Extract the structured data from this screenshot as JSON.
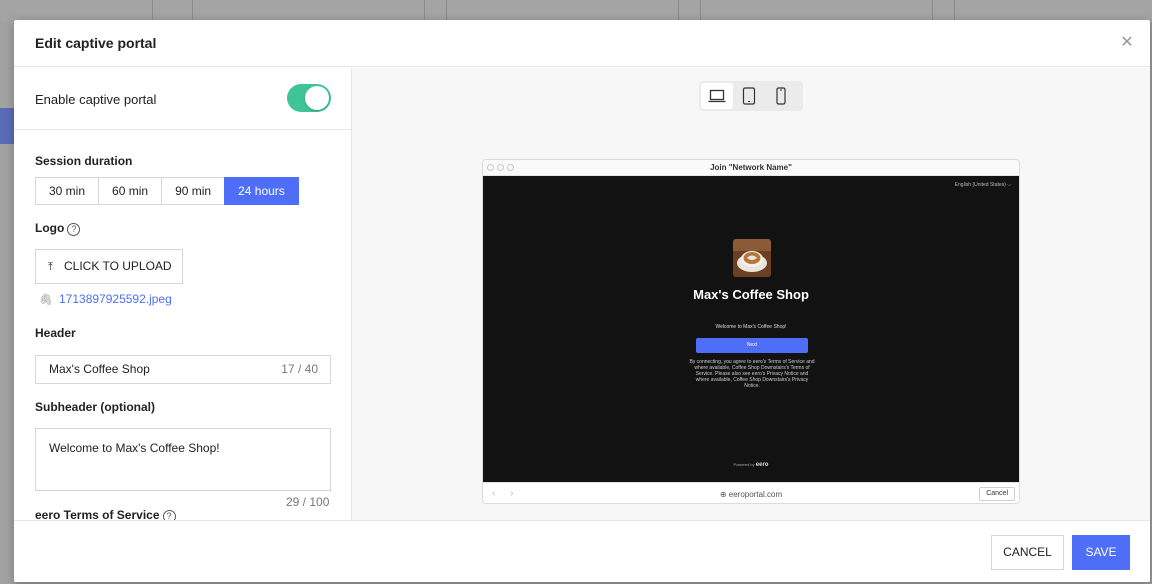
{
  "modal": {
    "title": "Edit captive portal",
    "close_glyph": "✕"
  },
  "form": {
    "enable_label": "Enable captive portal",
    "enable_on": true,
    "session_label": "Session duration",
    "session_options": [
      "30 min",
      "60 min",
      "90 min",
      "24 hours"
    ],
    "session_selected": "24 hours",
    "logo_label": "Logo",
    "upload_label": "CLICK TO UPLOAD",
    "uploaded_file": "1713897925592.jpeg",
    "header_label": "Header",
    "header_value": "Max's Coffee Shop",
    "header_count": "17 / 40",
    "subheader_label": "Subheader (optional)",
    "subheader_value": "Welcome to Max's Coffee Shop!",
    "subheader_count": "29 / 100",
    "terms_label": "eero Terms of Service"
  },
  "preview": {
    "devices": [
      "laptop-icon",
      "tablet-icon",
      "phone-icon"
    ],
    "selected_device": "laptop-icon",
    "window_title": "Join \"Network Name\"",
    "language": "English (United States) ⌵",
    "portal_header": "Max's Coffee Shop",
    "portal_subheader": "Welcome to Max's Coffee Shop!",
    "next_label": "Next",
    "terms_text": "By connecting, you agree to eero's Terms of Service and where available, Coffee Shop Downstairs's Terms of Service. Please also see eero's Privacy Notice and where available, Coffee Shop Downstairs's Privacy Notice.",
    "powered_by": "Powered by",
    "brand": "eero",
    "url": "⊕ eeroportal.com",
    "cancel_label": "Cancel"
  },
  "footer": {
    "cancel_label": "CANCEL",
    "save_label": "SAVE"
  },
  "colors": {
    "accent": "#4f6ef7",
    "toggle_on": "#3fc497",
    "portal_bg": "#121212"
  }
}
